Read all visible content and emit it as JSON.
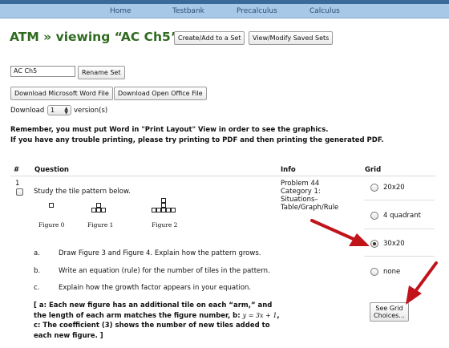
{
  "nav": {
    "items": [
      "Home",
      "Testbank",
      "Precalculus",
      "Calculus"
    ]
  },
  "header": {
    "title": "ATM » viewing “AC Ch5” »",
    "create_add_label": "Create/Add to a Set",
    "view_modify_label": "View/Modify Saved Sets"
  },
  "set": {
    "name_value": "AC Ch5",
    "rename_label": "Rename Set",
    "download_word_label": "Download Microsoft Word File",
    "download_openoffice_label": "Download Open Office File",
    "download_prefix": "Download",
    "versions_value": "1",
    "download_suffix": "version(s)"
  },
  "notice": {
    "line1": "Remember, you must put Word in \"Print Layout\" View in order to see the graphics.",
    "line2": "If you have any trouble printing, please try printing to PDF and then printing the generated PDF."
  },
  "table": {
    "headers": {
      "num": "#",
      "question": "Question",
      "info": "Info",
      "grid": "Grid"
    },
    "row": {
      "num": "1",
      "prompt": "Study the tile pattern below.",
      "figures": [
        "Figure 0",
        "Figure 1",
        "Figure 2"
      ],
      "items": [
        {
          "letter": "a.",
          "text": "Draw Figure 3 and Figure 4. Explain how the pattern grows."
        },
        {
          "letter": "b.",
          "text": "Write an equation (rule) for the number of tiles in the pattern."
        },
        {
          "letter": "c.",
          "text": "Explain how the growth factor appears in your equation."
        }
      ],
      "answer_part1": "[ a: Each new figure has an additional tile on each “arm,” and the length of each arm matches the figure number, b: ",
      "answer_equation": "y = 3x + 1",
      "answer_part2": ", c: The coefficient (3) shows the number of new tiles added to each new figure. ]",
      "info": {
        "problem": "Problem 44",
        "category_line1": "Category 1:",
        "category_line2": "Situations–",
        "category_line3": "Table/Graph/Rule"
      },
      "grid_options": [
        {
          "label": "20x20",
          "selected": false
        },
        {
          "label": "4 quadrant",
          "selected": false
        },
        {
          "label": "30x20",
          "selected": true
        },
        {
          "label": "none",
          "selected": false
        }
      ],
      "see_grid_label": "See Grid Choices..."
    }
  },
  "colors": {
    "title_green": "#2f6b1f",
    "nav_bg": "#a8c8e8",
    "arrow_red": "#c0141a"
  }
}
